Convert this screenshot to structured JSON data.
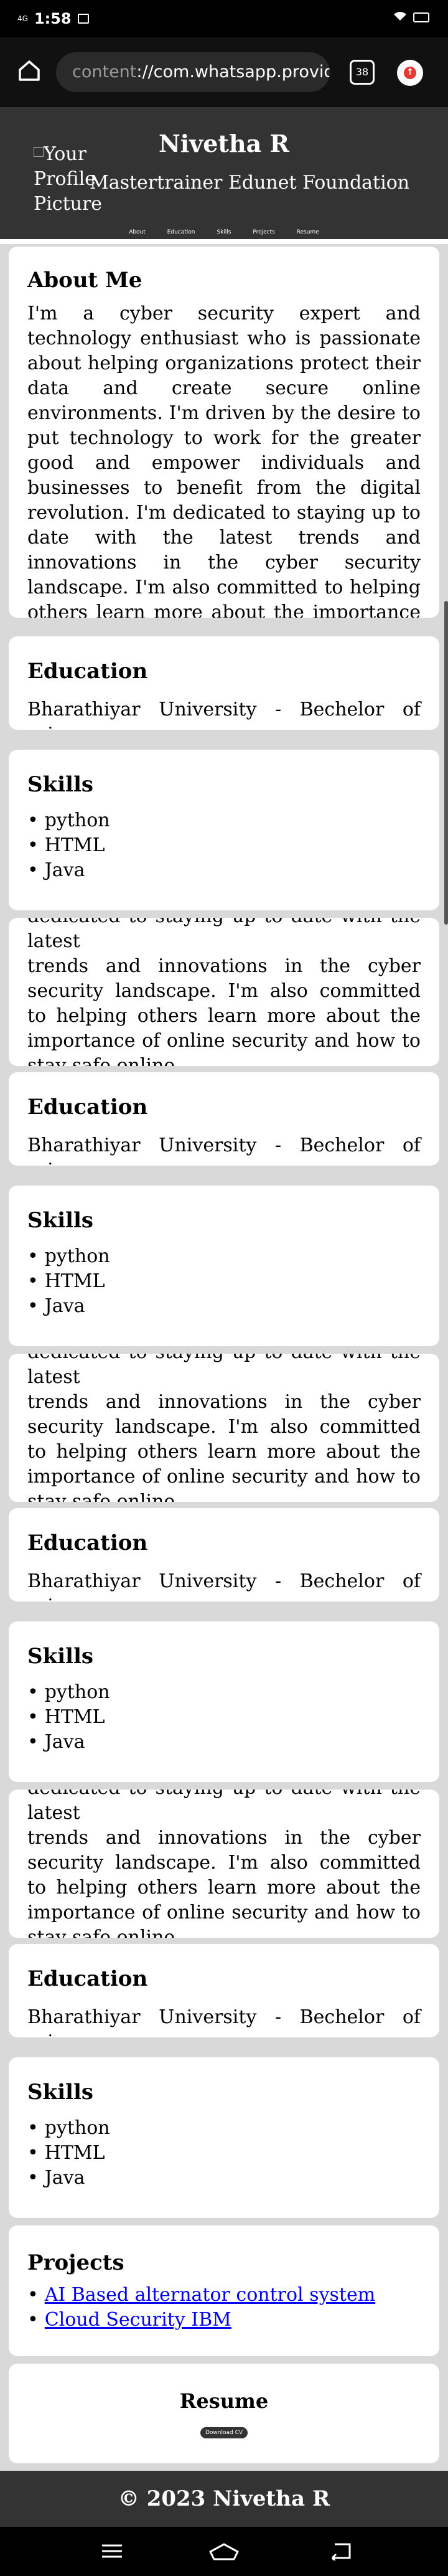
{
  "status_bar": {
    "network": "4G",
    "time": "1:58",
    "battery": ""
  },
  "browser": {
    "url_scheme": "content",
    "url_rest": "://com.whatsapp.provider",
    "tab_count": "38",
    "menu_badge": "↑"
  },
  "header": {
    "pic_alt": "Your Profile Picture",
    "name": "Nivetha R",
    "role": "Mastertrainer Edunet Foundation"
  },
  "nav": [
    "About",
    "Education",
    "Skills",
    "Projects",
    "Resume"
  ],
  "about": {
    "title": "About Me",
    "text": "I'm a cyber security expert and technology enthusiast who is passionate about helping organizations protect their data and create secure online environments. I'm driven by the desire to put technology to work for the greater good and empower individuals and businesses to benefit from the digital revolution. I'm dedicated to staying up to date with the latest trends and innovations in the cyber security landscape. I'm also committed to helping others learn more about the importance of online security and how to stay safe online.."
  },
  "about_cutoff": {
    "hidden_line": "dedicated to staying up to date with the latest",
    "text": "trends and innovations in the cyber security landscape. I'm also committed to helping others learn more about the importance of online security and how to stay safe online.."
  },
  "education": {
    "title": "Education",
    "text": "Bharathiyar University - Bechelor of science"
  },
  "skills": {
    "title": "Skills",
    "items": [
      "python",
      "HTML",
      "Java"
    ]
  },
  "projects": {
    "title": "Projects",
    "items": [
      "AI Based alternator control system",
      "Cloud Security IBM"
    ]
  },
  "resume": {
    "title": "Resume",
    "button": "Download CV"
  },
  "footer": {
    "text": "© 2023 Nivetha R"
  }
}
